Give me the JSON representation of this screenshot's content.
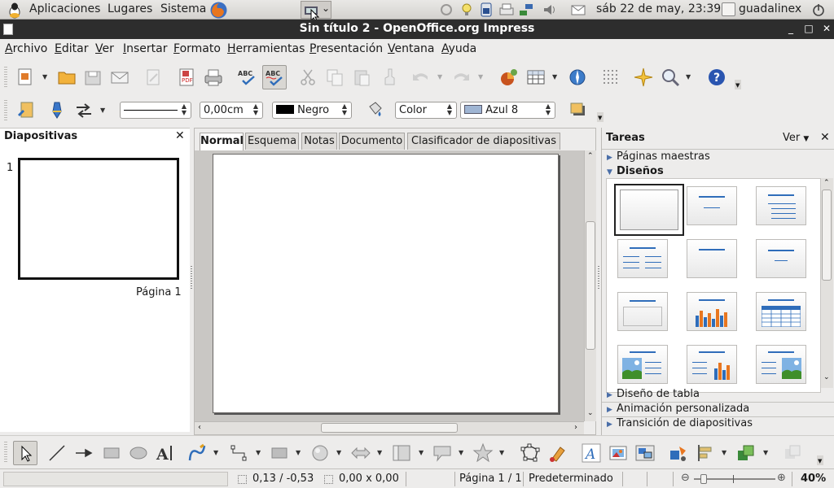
{
  "panel": {
    "menus": [
      "Aplicaciones",
      "Lugares",
      "Sistema"
    ],
    "clock": "sáb 22 de may, 23:39",
    "user": "guadalinex"
  },
  "window": {
    "title": "Sin título 2 - OpenOffice.org Impress",
    "controls": [
      "minimize",
      "maximize",
      "close"
    ]
  },
  "menubar": {
    "items": [
      {
        "label": "Archivo",
        "key": "A",
        "rest": "rchivo"
      },
      {
        "label": "Editar",
        "key": "E",
        "rest": "ditar"
      },
      {
        "label": "Ver",
        "key": "V",
        "rest": "er"
      },
      {
        "label": "Insertar",
        "key": "I",
        "rest": "nsertar"
      },
      {
        "label": "Formato",
        "key": "F",
        "rest": "ormato"
      },
      {
        "label": "Herramientas",
        "key": "H",
        "rest": "erramientas"
      },
      {
        "label": "Presentación",
        "key": "P",
        "rest": "resentación"
      },
      {
        "label": "Ventana",
        "key": "V",
        "rest": "entana"
      },
      {
        "label": "Ayuda",
        "key": "A",
        "rest": "yuda"
      }
    ]
  },
  "line_toolbar": {
    "line_width": "0,00cm",
    "line_color": "Negro",
    "area_style": "Color",
    "area_color": "Azul 8",
    "area_color_hex": "#9fb5d3"
  },
  "slides_pane": {
    "title": "Diapositivas",
    "slides": [
      {
        "number": "1",
        "label": "Página 1"
      }
    ]
  },
  "editor": {
    "tabs": [
      "Normal",
      "Esquema",
      "Notas",
      "Documento",
      "Clasificador de diapositivas"
    ],
    "active_tab": "Normal"
  },
  "task_pane": {
    "title": "Tareas",
    "view_menu": "Ver",
    "sections_top": [
      {
        "label": "Páginas maestras",
        "expanded": false
      },
      {
        "label": "Diseños",
        "expanded": true
      }
    ],
    "sections_bottom": [
      {
        "label": "Diseño de tabla",
        "expanded": false
      },
      {
        "label": "Animación personalizada",
        "expanded": false
      },
      {
        "label": "Transición de diapositivas",
        "expanded": false
      }
    ],
    "layouts": [
      "blank",
      "title-only",
      "title-content",
      "title-2content",
      "title-only-plain",
      "centered-text",
      "title-content-alt",
      "title-chart",
      "title-table",
      "title-image-text",
      "title-text-chart",
      "title-text-image"
    ]
  },
  "statusbar": {
    "position": "0,13 / -0,53",
    "size": "0,00 x 0,00",
    "page": "Página 1 / 1",
    "master": "Predeterminado",
    "zoom": "40%",
    "zoom_level": 0.4
  },
  "colors": {
    "accent": "#2f6dba",
    "titlebar": "#2d2d2d",
    "help": "#2a55b0"
  }
}
